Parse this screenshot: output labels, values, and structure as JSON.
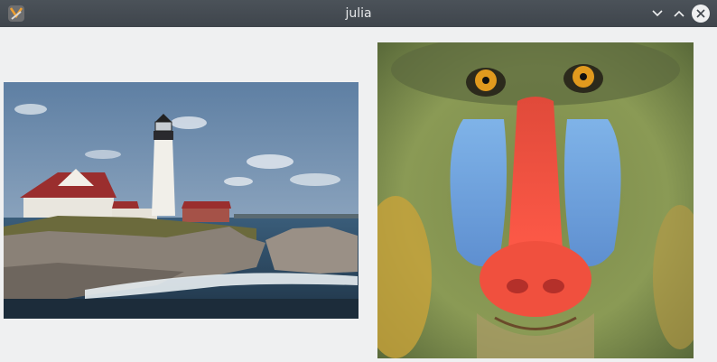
{
  "window": {
    "title": "julia",
    "controls": {
      "minimize_icon": "chevron-down-icon",
      "maximize_icon": "chevron-up-icon",
      "close_icon": "close-icon"
    }
  },
  "images": [
    {
      "name": "lighthouse-image",
      "description_icon": "photo"
    },
    {
      "name": "mandrill-image",
      "description_icon": "photo"
    }
  ],
  "colors": {
    "titlebar": "#474d54",
    "background": "#eff0f1"
  }
}
